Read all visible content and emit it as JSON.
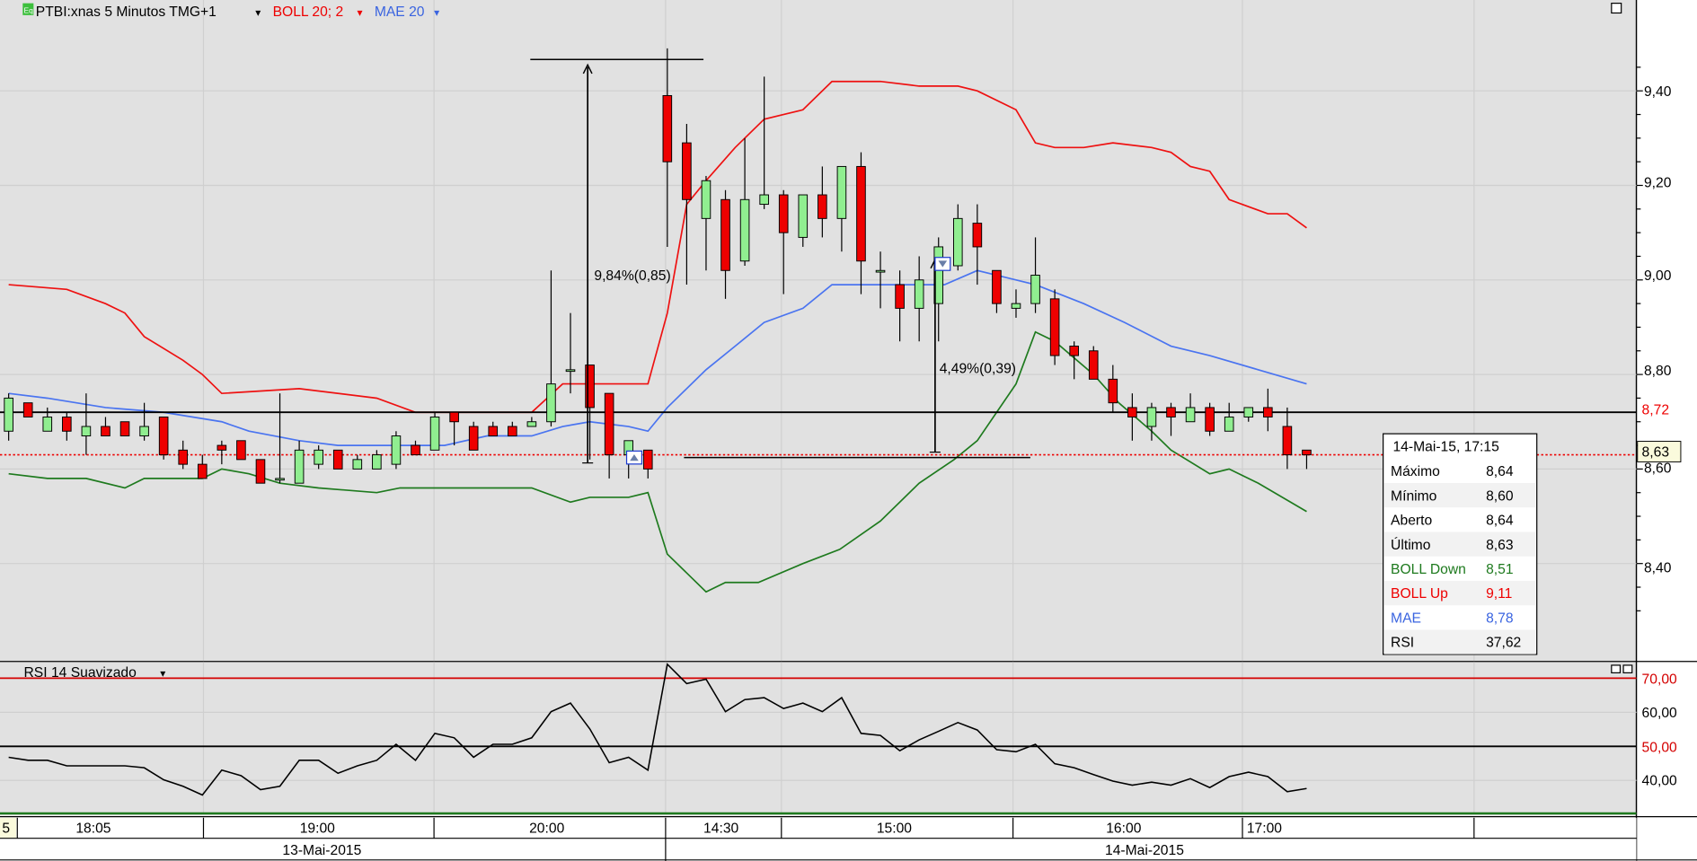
{
  "header": {
    "symbol": "PTBI:xnas 5 Minutos TMG+1",
    "boll": "BOLL 20; 2",
    "mae": "MAE 20",
    "dropdown": "▾",
    "eq_badge": "Eq"
  },
  "colors": {
    "up": "#90ee90",
    "down": "#ee0000",
    "boll": "#ee1111",
    "mae": "#4a74f0",
    "bolldown": "#1e7a1e",
    "bg": "#e1e1e1"
  },
  "price_axis": {
    "labels": [
      "9,40",
      "9,20",
      "9,00",
      "8,80",
      "8,60",
      "8,40"
    ],
    "values": [
      9.4,
      9.2,
      9.0,
      8.8,
      8.6,
      8.4
    ],
    "hline_label": "8,72",
    "hline_value": 8.72,
    "last_label": "8,63",
    "last_value": 8.63
  },
  "rulers": [
    {
      "label": "9,84%(0,85)",
      "from": 8.62,
      "to": 9.47
    },
    {
      "label": "4,49%(0,39)",
      "from": 8.63,
      "to": 9.02
    }
  ],
  "tooltip": {
    "title": "14-Mai-15, 17:15",
    "rows": [
      {
        "label": "Máximo",
        "value": "8,64",
        "color": "#000000"
      },
      {
        "label": "Mínimo",
        "value": "8,60",
        "color": "#000000"
      },
      {
        "label": "Aberto",
        "value": "8,64",
        "color": "#000000"
      },
      {
        "label": "Último",
        "value": "8,63",
        "color": "#000000"
      },
      {
        "label": "BOLL Down",
        "value": "8,51",
        "color": "#1e7a1e"
      },
      {
        "label": "BOLL Up",
        "value": "9,11",
        "color": "#ee0000"
      },
      {
        "label": "MAE",
        "value": "8,78",
        "color": "#3a64e0"
      },
      {
        "label": "RSI",
        "value": "37,62",
        "color": "#000000"
      }
    ]
  },
  "rsi_panel": {
    "title": "RSI 14 Suavizado",
    "labels": [
      "70,00",
      "60,00",
      "50,00",
      "40,00"
    ],
    "values": [
      70,
      60,
      50,
      40
    ]
  },
  "time_axis": {
    "first": "5",
    "times": [
      "18:05",
      "19:00",
      "20:00",
      "14:30",
      "15:00",
      "16:00",
      "17:00"
    ],
    "dates": [
      "13-Mai-2015",
      "14-Mai-2015"
    ]
  },
  "chart_data": {
    "type": "candlestick",
    "ylim": [
      8.28,
      9.52
    ],
    "candles": [
      [
        8.68,
        8.76,
        8.66,
        8.75
      ],
      [
        8.74,
        8.74,
        8.71,
        8.71
      ],
      [
        8.68,
        8.73,
        8.68,
        8.71
      ],
      [
        8.71,
        8.72,
        8.66,
        8.68
      ],
      [
        8.67,
        8.76,
        8.63,
        8.69
      ],
      [
        8.69,
        8.71,
        8.67,
        8.67
      ],
      [
        8.7,
        8.7,
        8.67,
        8.67
      ],
      [
        8.67,
        8.74,
        8.66,
        8.69
      ],
      [
        8.71,
        8.71,
        8.62,
        8.63
      ],
      [
        8.64,
        8.66,
        8.6,
        8.61
      ],
      [
        8.61,
        8.63,
        8.58,
        8.58
      ],
      [
        8.65,
        8.66,
        8.61,
        8.64
      ],
      [
        8.66,
        8.66,
        8.62,
        8.62
      ],
      [
        8.62,
        8.62,
        8.57,
        8.57
      ],
      [
        8.58,
        8.76,
        8.57,
        8.58
      ],
      [
        8.57,
        8.66,
        8.57,
        8.64
      ],
      [
        8.61,
        8.65,
        8.6,
        8.64
      ],
      [
        8.64,
        8.64,
        8.6,
        8.6
      ],
      [
        8.6,
        8.63,
        8.6,
        8.62
      ],
      [
        8.6,
        8.64,
        8.6,
        8.63
      ],
      [
        8.61,
        8.68,
        8.6,
        8.67
      ],
      [
        8.65,
        8.66,
        8.63,
        8.63
      ],
      [
        8.64,
        8.72,
        8.64,
        8.71
      ],
      [
        8.72,
        8.72,
        8.65,
        8.7
      ],
      [
        8.69,
        8.7,
        8.64,
        8.64
      ],
      [
        8.69,
        8.7,
        8.67,
        8.67
      ],
      [
        8.69,
        8.7,
        8.67,
        8.67
      ],
      [
        8.69,
        8.71,
        8.69,
        8.7
      ],
      [
        8.7,
        9.02,
        8.69,
        8.78
      ],
      [
        8.81,
        8.93,
        8.76,
        8.81
      ],
      [
        8.82,
        8.82,
        8.62,
        8.73
      ],
      [
        8.76,
        8.76,
        8.58,
        8.63
      ],
      [
        8.63,
        8.66,
        8.58,
        8.66
      ],
      [
        8.64,
        8.64,
        8.58,
        8.6
      ],
      [
        9.39,
        9.49,
        9.07,
        9.25
      ],
      [
        9.29,
        9.33,
        8.99,
        9.17
      ],
      [
        9.13,
        9.22,
        9.02,
        9.21
      ],
      [
        9.17,
        9.19,
        8.96,
        9.02
      ],
      [
        9.04,
        9.3,
        9.03,
        9.17
      ],
      [
        9.16,
        9.43,
        9.15,
        9.18
      ],
      [
        9.18,
        9.19,
        8.97,
        9.1
      ],
      [
        9.09,
        9.18,
        9.07,
        9.18
      ],
      [
        9.18,
        9.24,
        9.09,
        9.13
      ],
      [
        9.13,
        9.24,
        9.06,
        9.24
      ],
      [
        9.24,
        9.27,
        8.97,
        9.04
      ],
      [
        9.02,
        9.06,
        8.94,
        9.02
      ],
      [
        8.99,
        9.02,
        8.87,
        8.94
      ],
      [
        8.94,
        9.05,
        8.87,
        9.0
      ],
      [
        8.95,
        9.09,
        8.87,
        9.07
      ],
      [
        9.03,
        9.16,
        9.02,
        9.13
      ],
      [
        9.12,
        9.16,
        8.99,
        9.07
      ],
      [
        9.02,
        9.02,
        8.93,
        8.95
      ],
      [
        8.94,
        8.98,
        8.92,
        8.95
      ],
      [
        8.95,
        9.09,
        8.93,
        9.01
      ],
      [
        8.96,
        8.98,
        8.82,
        8.84
      ],
      [
        8.86,
        8.87,
        8.79,
        8.84
      ],
      [
        8.85,
        8.86,
        8.79,
        8.79
      ],
      [
        8.79,
        8.82,
        8.72,
        8.74
      ],
      [
        8.73,
        8.76,
        8.66,
        8.71
      ],
      [
        8.69,
        8.74,
        8.66,
        8.73
      ],
      [
        8.73,
        8.74,
        8.67,
        8.71
      ],
      [
        8.7,
        8.76,
        8.7,
        8.73
      ],
      [
        8.73,
        8.74,
        8.67,
        8.68
      ],
      [
        8.68,
        8.74,
        8.68,
        8.71
      ],
      [
        8.71,
        8.73,
        8.7,
        8.73
      ],
      [
        8.73,
        8.77,
        8.68,
        8.71
      ],
      [
        8.69,
        8.73,
        8.6,
        8.63
      ],
      [
        8.64,
        8.64,
        8.6,
        8.63
      ]
    ],
    "boll_up": [
      [
        0,
        8.99
      ],
      [
        3,
        8.98
      ],
      [
        5,
        8.95
      ],
      [
        6,
        8.93
      ],
      [
        7,
        8.88
      ],
      [
        9,
        8.83
      ],
      [
        10,
        8.8
      ],
      [
        11,
        8.76
      ],
      [
        15,
        8.77
      ],
      [
        19,
        8.75
      ],
      [
        21,
        8.72
      ],
      [
        27,
        8.72
      ],
      [
        28.6,
        8.78
      ],
      [
        30,
        8.78
      ],
      [
        33,
        8.78
      ],
      [
        34,
        8.93
      ],
      [
        35,
        9.16
      ],
      [
        36,
        9.21
      ],
      [
        37.5,
        9.28
      ],
      [
        39,
        9.34
      ],
      [
        41,
        9.36
      ],
      [
        42.5,
        9.42
      ],
      [
        45,
        9.42
      ],
      [
        47,
        9.41
      ],
      [
        49,
        9.41
      ],
      [
        50,
        9.4
      ],
      [
        52,
        9.36
      ],
      [
        53,
        9.29
      ],
      [
        54,
        9.28
      ],
      [
        55.5,
        9.28
      ],
      [
        57,
        9.29
      ],
      [
        59,
        9.28
      ],
      [
        60,
        9.27
      ],
      [
        61,
        9.24
      ],
      [
        62,
        9.23
      ],
      [
        63,
        9.17
      ],
      [
        65,
        9.14
      ],
      [
        66,
        9.14
      ],
      [
        67,
        9.11
      ]
    ],
    "mae": [
      [
        0,
        8.76
      ],
      [
        2,
        8.75
      ],
      [
        5,
        8.73
      ],
      [
        8,
        8.72
      ],
      [
        11,
        8.7
      ],
      [
        12.4,
        8.68
      ],
      [
        15,
        8.66
      ],
      [
        17,
        8.65
      ],
      [
        19,
        8.65
      ],
      [
        22.5,
        8.65
      ],
      [
        24.7,
        8.67
      ],
      [
        27,
        8.67
      ],
      [
        28.6,
        8.69
      ],
      [
        30,
        8.7
      ],
      [
        32,
        8.69
      ],
      [
        33,
        8.68
      ],
      [
        34,
        8.73
      ],
      [
        36,
        8.81
      ],
      [
        37.5,
        8.86
      ],
      [
        39,
        8.91
      ],
      [
        41,
        8.94
      ],
      [
        42.5,
        8.99
      ],
      [
        45,
        8.99
      ],
      [
        47,
        8.99
      ],
      [
        48.3,
        8.99
      ],
      [
        50,
        9.02
      ],
      [
        52,
        9.0
      ],
      [
        53,
        8.99
      ],
      [
        55.5,
        8.95
      ],
      [
        57.6,
        8.91
      ],
      [
        60,
        8.86
      ],
      [
        62,
        8.84
      ],
      [
        64.5,
        8.81
      ],
      [
        67,
        8.78
      ]
    ],
    "boll_down": [
      [
        0,
        8.59
      ],
      [
        2,
        8.58
      ],
      [
        4,
        8.58
      ],
      [
        6,
        8.56
      ],
      [
        7,
        8.58
      ],
      [
        8,
        8.58
      ],
      [
        10,
        8.58
      ],
      [
        11,
        8.6
      ],
      [
        12.4,
        8.59
      ],
      [
        14,
        8.57
      ],
      [
        16,
        8.56
      ],
      [
        19,
        8.55
      ],
      [
        20.2,
        8.56
      ],
      [
        22,
        8.56
      ],
      [
        27,
        8.56
      ],
      [
        29,
        8.53
      ],
      [
        30,
        8.54
      ],
      [
        32,
        8.54
      ],
      [
        33,
        8.55
      ],
      [
        34,
        8.42
      ],
      [
        35,
        8.38
      ],
      [
        36,
        8.34
      ],
      [
        37,
        8.36
      ],
      [
        38.7,
        8.36
      ],
      [
        41,
        8.4
      ],
      [
        42.9,
        8.43
      ],
      [
        45,
        8.49
      ],
      [
        47,
        8.57
      ],
      [
        48.8,
        8.62
      ],
      [
        50,
        8.66
      ],
      [
        52,
        8.78
      ],
      [
        53,
        8.89
      ],
      [
        54,
        8.87
      ],
      [
        56,
        8.8
      ],
      [
        57.3,
        8.74
      ],
      [
        59,
        8.68
      ],
      [
        60,
        8.64
      ],
      [
        62,
        8.59
      ],
      [
        63,
        8.6
      ],
      [
        64.5,
        8.57
      ],
      [
        67,
        8.51
      ]
    ],
    "rsi": [
      46.8,
      45.9,
      45.9,
      44.3,
      44.3,
      44.3,
      44.3,
      43.7,
      40.2,
      38.3,
      35.7,
      43.0,
      41.4,
      37.3,
      38.3,
      45.9,
      45.9,
      42.1,
      44.3,
      45.9,
      50.6,
      45.9,
      53.8,
      52.5,
      46.8,
      50.6,
      50.6,
      52.5,
      60.2,
      62.7,
      55.1,
      45.2,
      46.8,
      43.0,
      74.1,
      68.4,
      69.7,
      60.2,
      63.7,
      64.3,
      61.1,
      62.7,
      60.2,
      64.3,
      53.8,
      53.2,
      48.7,
      51.9,
      54.4,
      57.0,
      54.8,
      49.0,
      48.4,
      50.6,
      44.9,
      43.7,
      41.7,
      39.8,
      38.6,
      39.5,
      38.6,
      40.5,
      37.9,
      41.1,
      42.4,
      41.1,
      36.7,
      37.62
    ]
  }
}
